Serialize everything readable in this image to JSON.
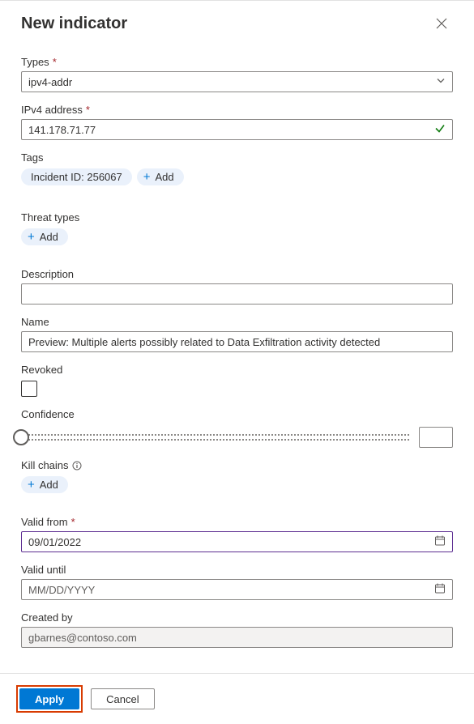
{
  "header": {
    "title": "New indicator"
  },
  "types": {
    "label": "Types",
    "required": "*",
    "value": "ipv4-addr"
  },
  "ipv4": {
    "label": "IPv4 address",
    "required": "*",
    "value": "141.178.71.77"
  },
  "tags": {
    "label": "Tags",
    "items": [
      "Incident ID: 256067"
    ],
    "add": "Add"
  },
  "threat_types": {
    "label": "Threat types",
    "add": "Add"
  },
  "description": {
    "label": "Description",
    "value": ""
  },
  "name": {
    "label": "Name",
    "value": "Preview: Multiple alerts possibly related to Data Exfiltration activity detected"
  },
  "revoked": {
    "label": "Revoked"
  },
  "confidence": {
    "label": "Confidence"
  },
  "kill_chains": {
    "label": "Kill chains",
    "add": "Add"
  },
  "valid_from": {
    "label": "Valid from",
    "required": "*",
    "value": "09/01/2022"
  },
  "valid_until": {
    "label": "Valid until",
    "placeholder": "MM/DD/YYYY"
  },
  "created_by": {
    "label": "Created by",
    "value": "gbarnes@contoso.com"
  },
  "footer": {
    "apply": "Apply",
    "cancel": "Cancel"
  }
}
